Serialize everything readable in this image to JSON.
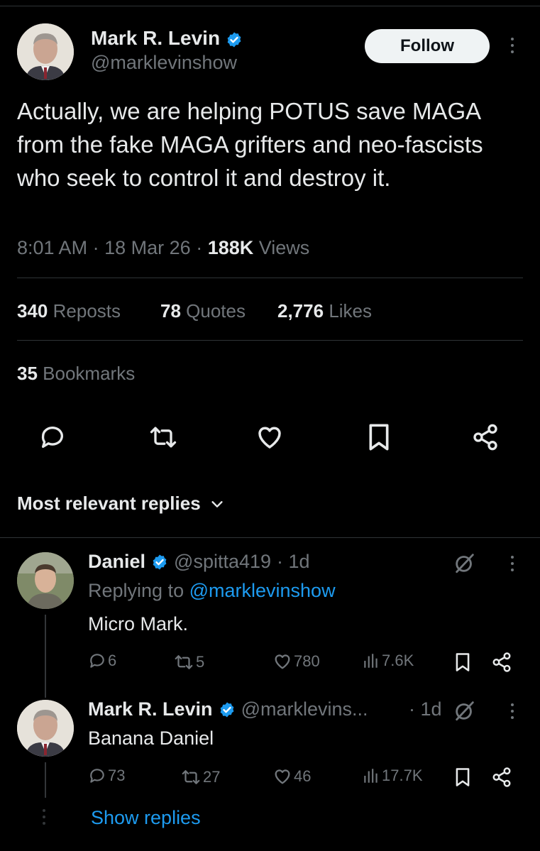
{
  "tweet": {
    "author_name": "Mark R. Levin",
    "author_handle": "@marklevinshow",
    "follow_label": "Follow",
    "text": "Actually, we are helping POTUS save MAGA from the fake MAGA grifters and neo-fascists who seek to control it and destroy it.",
    "time": "8:01 AM",
    "date": "18 Mar 26",
    "views_count": "188K",
    "views_label": "Views",
    "separator": "·"
  },
  "stats": {
    "reposts_count": "340",
    "reposts_label": "Reposts",
    "quotes_count": "78",
    "quotes_label": "Quotes",
    "likes_count": "2,776",
    "likes_label": "Likes",
    "bookmarks_count": "35",
    "bookmarks_label": "Bookmarks"
  },
  "actions": [
    "reply-icon",
    "repost-icon",
    "like-icon",
    "bookmark-icon",
    "share-icon"
  ],
  "replies_header": {
    "label": "Most relevant replies"
  },
  "replies": [
    {
      "name": "Daniel",
      "handle": "@spitta419",
      "age": "· 1d",
      "replying_prefix": "Replying to",
      "replying_handle": "@marklevinshow",
      "text": "Micro Mark.",
      "reply_count": "6",
      "repost_count": "5",
      "like_count": "780",
      "view_count": "7.6K"
    },
    {
      "name": "Mark R. Levin",
      "handle": "@marklevins...",
      "age": "· 1d",
      "text": "Banana Daniel",
      "reply_count": "73",
      "repost_count": "27",
      "like_count": "46",
      "view_count": "17.7K"
    }
  ],
  "show_replies_label": "Show replies",
  "colors": {
    "background": "#000000",
    "text": "#e7e9ea",
    "muted": "#71767b",
    "accent": "#1d9bf0",
    "divider": "#2f3336"
  }
}
